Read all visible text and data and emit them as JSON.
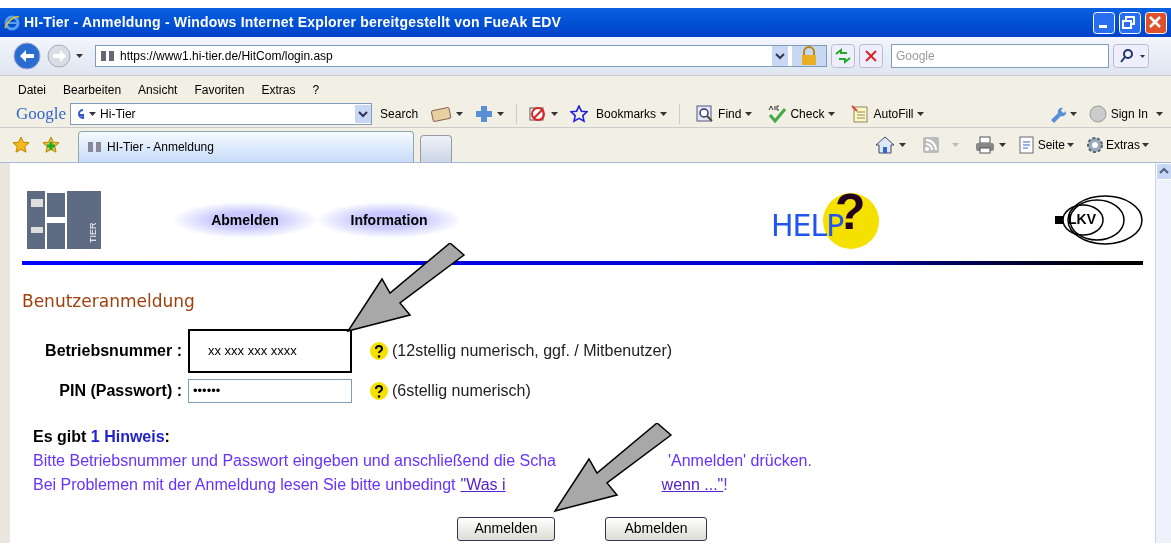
{
  "window": {
    "title": "HI-Tier - Anmeldung - Windows Internet Explorer bereitgestellt von FueAk EDV"
  },
  "address_bar": {
    "url": "https://www1.hi-tier.de/HitCom/login.asp"
  },
  "search_box": {
    "placeholder": "Google"
  },
  "menu": [
    "Datei",
    "Bearbeiten",
    "Ansicht",
    "Favoriten",
    "Extras",
    "?"
  ],
  "google_toolbar": {
    "brand": "Google",
    "query": "Hi-Tier",
    "search": "Search",
    "items": [
      {
        "label": "Bookmarks"
      },
      {
        "label": "Find"
      },
      {
        "label": "Check"
      },
      {
        "label": "AutoFill"
      }
    ],
    "sign_in": "Sign In"
  },
  "tabs": [
    {
      "label": "HI-Tier - Anmeldung",
      "selected": true
    }
  ],
  "command_bar": [
    "Seite",
    "Extras"
  ],
  "page": {
    "logo_text": "TIER",
    "nav": [
      "Abmelden",
      "Information"
    ],
    "help_logo": {
      "word": "HELP",
      "mark": "?"
    },
    "lkv_logo": "LKV",
    "heading": "Benutzeranmeldung",
    "fields": [
      {
        "label": "Betriebsnummer :",
        "value": "xx xxx xxx xxxx",
        "hint": "(12stellig numerisch, ggf. / Mitbenutzer)",
        "annotated": true
      },
      {
        "label": "PIN (Passwort) :",
        "value": "••••••",
        "hint": "(6stellig numerisch)",
        "annotated": false
      }
    ],
    "notice": {
      "text_before": "Es gibt",
      "count": "1 Hinweis",
      "text_after": ":"
    },
    "notice_line_1": [
      "Bitte Betriebsnummer und Passwort eingeben und anschließend die Scha",
      "'Anmelden' drücken."
    ],
    "notice_line_2": {
      "text": "Bei Problemen mit der Anmeldung lesen Sie bitte unbedingt",
      "link": [
        "\"Was i",
        "wenn ...\""
      ],
      "text_after": "!"
    },
    "buttons": [
      "Anmelden",
      "Abmelden"
    ]
  }
}
